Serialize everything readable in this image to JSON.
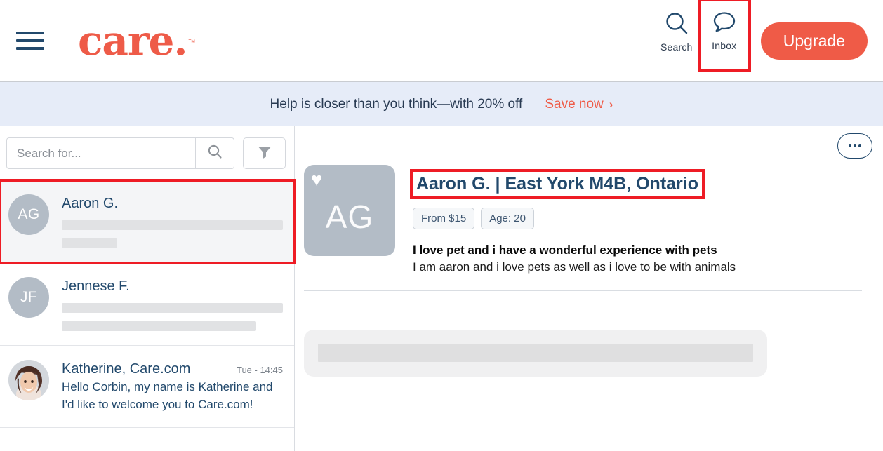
{
  "header": {
    "menu_icon": "hamburger-menu-icon",
    "logo_text": "care.",
    "logo_tm": "™",
    "actions": [
      {
        "icon": "search-icon",
        "label": "Search",
        "highlighted": false
      },
      {
        "icon": "chat-bubble-icon",
        "label": "Inbox",
        "highlighted": true
      }
    ],
    "upgrade_label": "Upgrade"
  },
  "banner": {
    "text": "Help is closer than you think—with 20% off",
    "link_label": "Save now",
    "chevron": "›"
  },
  "sidebar": {
    "search": {
      "placeholder": "Search for...",
      "value": "",
      "search_icon": "magnifier-icon",
      "filter_icon": "funnel-filter-icon"
    },
    "conversations": [
      {
        "initials": "AG",
        "name": "Aaron G.",
        "time": "",
        "preview": "",
        "skeleton": true,
        "selected": true,
        "avatar_type": "initials"
      },
      {
        "initials": "JF",
        "name": "Jennese F.",
        "time": "",
        "preview": "",
        "skeleton": true,
        "selected": false,
        "avatar_type": "initials"
      },
      {
        "initials": "",
        "name": "Katherine, Care.com",
        "time": "Tue - 14:45",
        "preview": "Hello Corbin, my name is Katherine and I'd like to welcome you to Care.com!",
        "skeleton": false,
        "selected": false,
        "avatar_type": "photo"
      }
    ]
  },
  "main": {
    "more_button": "more-options-ellipsis",
    "profile": {
      "initials": "AG",
      "favorite_icon": "heart-icon",
      "title": "Aaron G. | East York M4B, Ontario",
      "badges": [
        "From $15",
        "Age: 20"
      ],
      "headline": "I love pet and i have a wonderful experience with pets",
      "description": "I am aaron and i love pets as well as i love to be with animals"
    }
  },
  "colors": {
    "brand_coral": "#ef5b47",
    "navy": "#22496c",
    "banner_bg": "#e6ecf8",
    "annotation_red": "#ee1c25",
    "avatar_gray": "#b3bcc6"
  }
}
